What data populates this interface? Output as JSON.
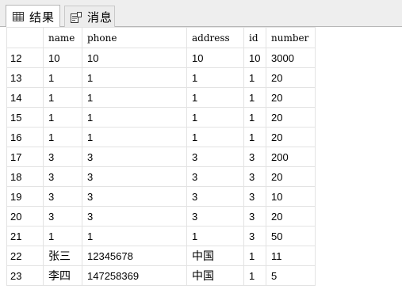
{
  "tabs": [
    {
      "label": "结果",
      "icon": "grid-icon"
    },
    {
      "label": "消息",
      "icon": "message-icon"
    }
  ],
  "table": {
    "columns": [
      "",
      "name",
      "phone",
      "address",
      "id",
      "number"
    ],
    "rows": [
      {
        "rownum": "12",
        "name": "10",
        "phone": "10",
        "address": "10",
        "id": "10",
        "number": "3000"
      },
      {
        "rownum": "13",
        "name": "1",
        "phone": "1",
        "address": "1",
        "id": "1",
        "number": "20"
      },
      {
        "rownum": "14",
        "name": "1",
        "phone": "1",
        "address": "1",
        "id": "1",
        "number": "20"
      },
      {
        "rownum": "15",
        "name": "1",
        "phone": "1",
        "address": "1",
        "id": "1",
        "number": "20"
      },
      {
        "rownum": "16",
        "name": "1",
        "phone": "1",
        "address": "1",
        "id": "1",
        "number": "20"
      },
      {
        "rownum": "17",
        "name": "3",
        "phone": "3",
        "address": "3",
        "id": "3",
        "number": "200"
      },
      {
        "rownum": "18",
        "name": "3",
        "phone": "3",
        "address": "3",
        "id": "3",
        "number": "20"
      },
      {
        "rownum": "19",
        "name": "3",
        "phone": "3",
        "address": "3",
        "id": "3",
        "number": "10"
      },
      {
        "rownum": "20",
        "name": "3",
        "phone": "3",
        "address": "3",
        "id": "3",
        "number": "20"
      },
      {
        "rownum": "21",
        "name": "1",
        "phone": "1",
        "address": "1",
        "id": "3",
        "number": "50"
      },
      {
        "rownum": "22",
        "name": "张三",
        "phone": "12345678",
        "address": "中国",
        "id": "1",
        "number": "11"
      },
      {
        "rownum": "23",
        "name": "李四",
        "phone": "147258369",
        "address": "中国",
        "id": "1",
        "number": "5"
      }
    ]
  },
  "colors": {
    "tabstrip_bg": "#eeeeee",
    "grid_line": "#e3e3e3",
    "border": "#b7b7b7"
  }
}
